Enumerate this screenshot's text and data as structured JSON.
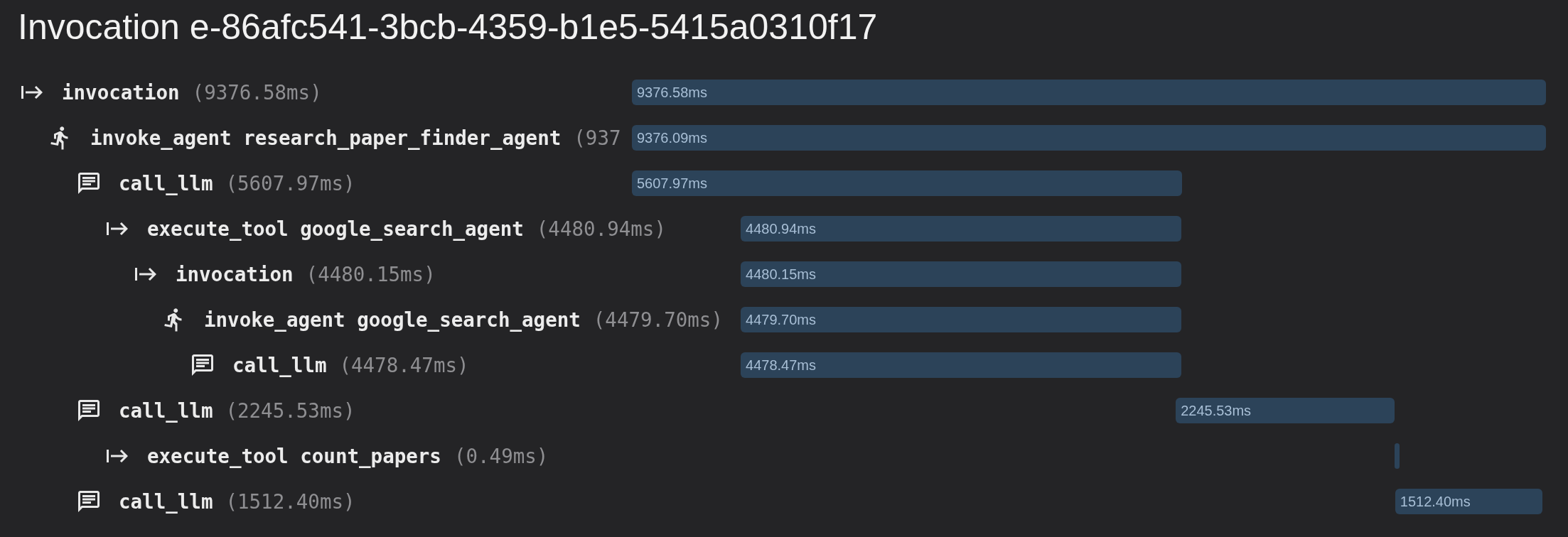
{
  "title": "Invocation e-86afc541-3bcb-4359-b1e5-5415a0310f17",
  "spans": [
    {
      "kind": "invocation",
      "name": "invocation",
      "duration": "(9376.58ms)",
      "bar": {
        "label": "9376.58ms"
      },
      "children": [
        {
          "kind": "agent",
          "name": "invoke_agent research_paper_finder_agent",
          "duration": "(937",
          "bar": {
            "label": "9376.09ms"
          },
          "children": [
            {
              "kind": "llm",
              "name": "call_llm",
              "duration": "(5607.97ms)",
              "bar": {
                "label": "5607.97ms"
              },
              "children": [
                {
                  "kind": "tool",
                  "name": "execute_tool google_search_agent",
                  "duration": "(4480.94ms)",
                  "bar": {
                    "label": "4480.94ms"
                  },
                  "children": [
                    {
                      "kind": "invocation",
                      "name": "invocation",
                      "duration": "(4480.15ms)",
                      "bar": {
                        "label": "4480.15ms"
                      },
                      "children": [
                        {
                          "kind": "agent",
                          "name": "invoke_agent google_search_agent",
                          "duration": "(4479.70ms)",
                          "bar": {
                            "label": "4479.70ms"
                          },
                          "children": [
                            {
                              "kind": "llm",
                              "name": "call_llm",
                              "duration": "(4478.47ms)",
                              "bar": {
                                "label": "4478.47ms"
                              }
                            }
                          ]
                        }
                      ]
                    }
                  ]
                }
              ]
            },
            {
              "kind": "llm",
              "name": "call_llm",
              "duration": "(2245.53ms)",
              "bar": {
                "label": "2245.53ms"
              },
              "children": [
                {
                  "kind": "tool",
                  "name": "execute_tool count_papers",
                  "duration": "(0.49ms)"
                }
              ]
            },
            {
              "kind": "llm",
              "name": "call_llm",
              "duration": "(1512.40ms)",
              "bar": {
                "label": "1512.40ms"
              }
            }
          ]
        }
      ]
    }
  ]
}
